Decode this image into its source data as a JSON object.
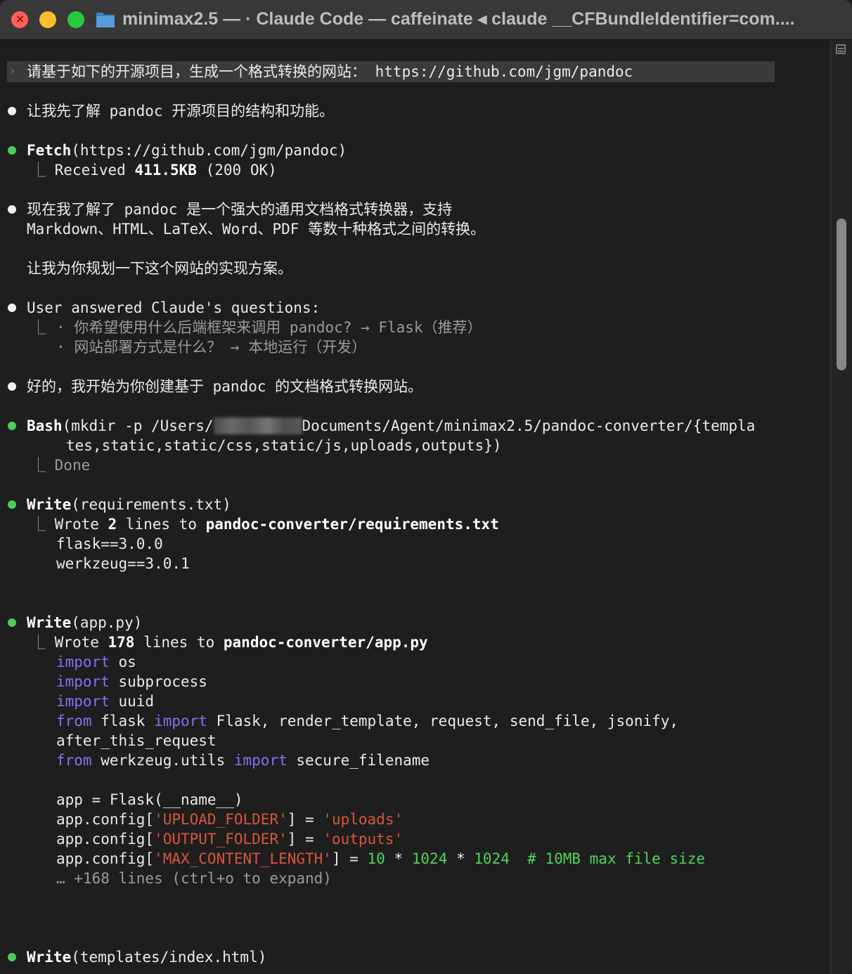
{
  "window": {
    "title": "minimax2.5 — · Claude Code — caffeinate ◂ claude __CFBundleIdentifier=com...."
  },
  "prompt": {
    "text": "请基于如下的开源项目，生成一个格式转换的网站： https://github.com/jgm/pandoc"
  },
  "blocks": {
    "intro": "让我先了解 pandoc 开源项目的结构和功能。",
    "fetch": {
      "tool": "Fetch",
      "args": "(https://github.com/jgm/pandoc)",
      "received_label": "Received ",
      "size": "411.5KB",
      "status": " (200 OK)"
    },
    "understand": {
      "line1": "现在我了解了 pandoc 是一个强大的通用文档格式转换器，支持",
      "line2": "Markdown、HTML、LaTeX、Word、PDF 等数十种格式之间的转换。",
      "line3": "让我为你规划一下这个网站的实现方案。"
    },
    "questions": {
      "header": "User answered Claude's questions:",
      "q1": "· 你希望使用什么后端框架来调用 pandoc? → Flask（推荐）",
      "q2": "· 网站部署方式是什么？ → 本地运行（开发）"
    },
    "start": "好的，我开始为你创建基于 pandoc 的文档格式转换网站。",
    "bash": {
      "tool": "Bash",
      "args_pre": "(mkdir -p /Users/",
      "args_post": "Documents/Agent/minimax2.5/pandoc-converter/{templa",
      "args_cont": "tes,static,static/css,static/js,uploads,outputs})",
      "result": "Done"
    },
    "write_req": {
      "tool": "Write",
      "args": "(requirements.txt)",
      "wrote": "Wrote ",
      "count": "2",
      "mid": " lines to ",
      "path": "pandoc-converter/requirements.txt",
      "code1": "flask==3.0.0",
      "code2": "werkzeug==3.0.1"
    },
    "write_app": {
      "tool": "Write",
      "args": "(app.py)",
      "wrote": "Wrote ",
      "count": "178",
      "mid": " lines to ",
      "path": "pandoc-converter/app.py",
      "kw_import": "import",
      "kw_from": "from",
      "mod_os": " os",
      "mod_subprocess": " subprocess",
      "mod_uuid": " uuid",
      "flask_mod": " flask ",
      "flask_names": " Flask, render_template, request, send_file, jsonify,",
      "flask_cont": "after_this_request",
      "werk_mod": " werkzeug.utils ",
      "werk_names": " secure_filename",
      "app_line": "app = Flask(__name__)",
      "cfg_prefix": "app.config[",
      "cfg_upload_key": "'UPLOAD_FOLDER'",
      "cfg_upload_val": "'uploads'",
      "cfg_output_key": "'OUTPUT_FOLDER'",
      "cfg_output_val": "'outputs'",
      "cfg_max_key": "'MAX_CONTENT_LENGTH'",
      "assign": "] = ",
      "n10": "10",
      "times": " * ",
      "n1024": "1024",
      "comment": "# 10MB max file size",
      "more": "… +168 lines (ctrl+o to expand)"
    },
    "write_html": {
      "tool": "Write",
      "args": "(templates/index.html)"
    }
  }
}
